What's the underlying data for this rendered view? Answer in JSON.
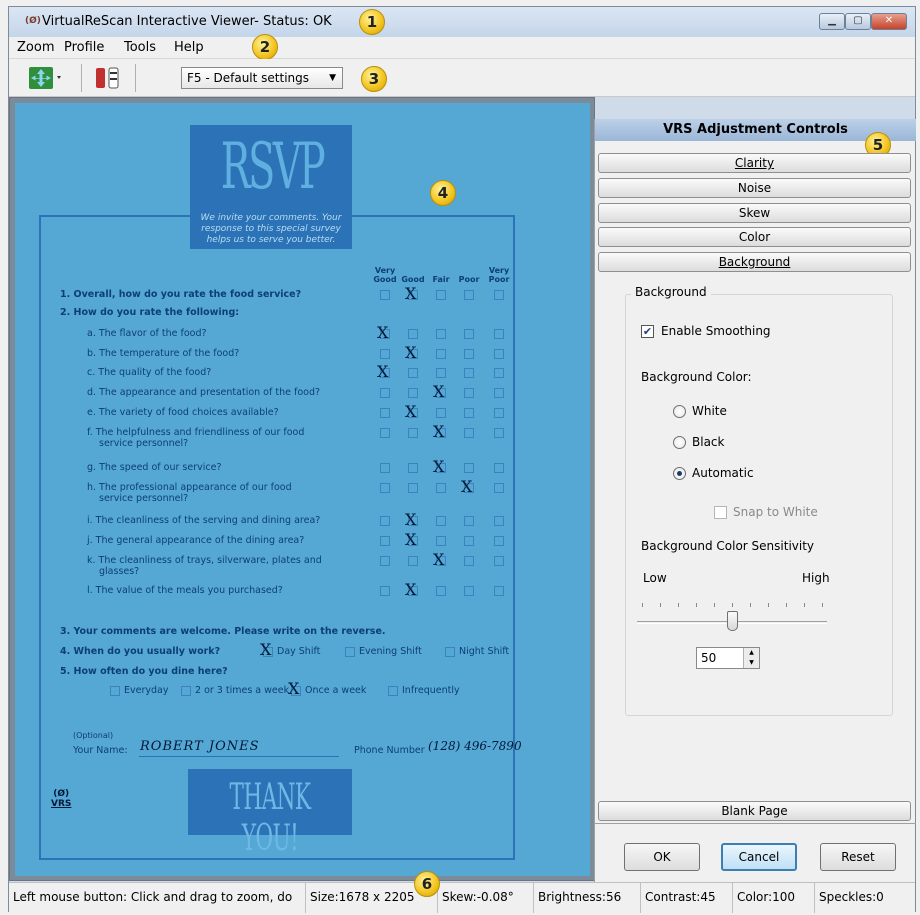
{
  "window": {
    "title": "VirtualReScan Interactive Viewer- Status: OK",
    "icon": "vrs-app-icon"
  },
  "menu": [
    "Zoom",
    "Profile",
    "Tools",
    "Help"
  ],
  "toolbar": {
    "profile_value": "F5 - Default settings"
  },
  "callouts": [
    "1",
    "2",
    "3",
    "4",
    "5",
    "6"
  ],
  "document": {
    "header_big": "RSVP",
    "header_sub": "We invite your comments. Your response to this special survey helps us to serve you better.",
    "rating_columns": [
      {
        "top": "Very",
        "bottom": "Good"
      },
      {
        "top": "",
        "bottom": "Good"
      },
      {
        "top": "",
        "bottom": "Fair"
      },
      {
        "top": "",
        "bottom": "Poor"
      },
      {
        "top": "Very",
        "bottom": "Poor"
      }
    ],
    "q1": "1. Overall, how do you rate the food service?",
    "q2": "2. How do you rate the following:",
    "items": [
      "a. The flavor of the food?",
      "b. The temperature of the food?",
      "c. The quality of the food?",
      "d. The appearance and presentation of the food?",
      "e. The variety of food choices available?",
      "f. The helpfulness and friendliness of our food",
      "g. The speed of our service?",
      "h. The professional appearance of our food",
      "i. The cleanliness of the serving and dining area?",
      "j. The general appearance of the dining area?",
      "k. The cleanliness of trays, silverware, plates and",
      "l. The value of the meals you purchased?"
    ],
    "item_cont": {
      "f": "service personnel?",
      "h": "service personnel?",
      "k": "glasses?"
    },
    "q3": "3. Your comments are welcome.  Please write on the reverse.",
    "q4": "4. When do you usually work?",
    "shifts": [
      "Day Shift",
      "Evening Shift",
      "Night Shift"
    ],
    "q5": "5. How often do you dine here?",
    "freq": [
      "Everyday",
      "2 or 3 times a week",
      "Once a week",
      "Infrequently"
    ],
    "optional": "(Optional)",
    "name_label": "Your Name:",
    "name_value": "ROBERT JONES",
    "phone_label": "Phone Number",
    "phone_value": "(128) 496-7890",
    "thanks": "THANK YOU!",
    "logo": "VRS",
    "mark": "X"
  },
  "panel": {
    "title": "VRS Adjustment Controls",
    "sections": [
      "Clarity",
      "Noise",
      "Skew",
      "Color",
      "Background"
    ],
    "group_title": "Background",
    "enable_smoothing": "Enable Smoothing",
    "enable_smoothing_checked": true,
    "bg_color_label": "Background Color:",
    "radios": [
      "White",
      "Black",
      "Automatic"
    ],
    "radio_selected": "Automatic",
    "snap_to_white": "Snap to White",
    "sensitivity_label": "Background Color Sensitivity",
    "low": "Low",
    "high": "High",
    "sensitivity_value": "50",
    "sensitivity_fraction": 0.5,
    "blank_page": "Blank Page",
    "ok": "OK",
    "cancel": "Cancel",
    "reset": "Reset"
  },
  "status": {
    "hint": "Left mouse button: Click and drag to zoom, do",
    "size": "Size:1678 x 2205",
    "skew": "Skew:-0.08°",
    "brightness": "Brightness:56",
    "contrast": "Contrast:45",
    "color": "Color:100",
    "speckles": "Speckles:0"
  },
  "colors": {
    "doc_bg": "#55a7d4",
    "doc_dark": "#2b73b6",
    "badge": "#f2c21b",
    "panel_title": "#9ab6d6"
  }
}
